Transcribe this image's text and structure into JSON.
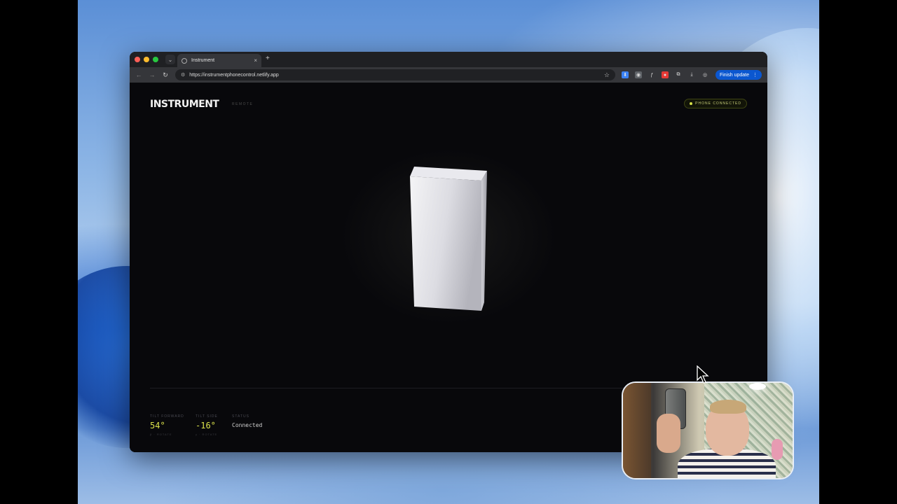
{
  "browser": {
    "tab_title": "Instrument",
    "tab_close": "×",
    "new_tab": "+",
    "url": "https://instrumentphonecontrol.netlify.app",
    "finish_update_label": "Finish update",
    "finish_update_menu": "⋮",
    "back": "←",
    "forward": "→",
    "reload": "↻",
    "bookmark": "☆",
    "tab_menu": "⌄"
  },
  "app": {
    "brand": "INSTRUMENT",
    "brand_sub": "REMOTE",
    "status_pill": "PHONE CONNECTED",
    "stats": [
      {
        "label": "TILT FORWARD",
        "value": "54°",
        "hint": "β · ROTATE"
      },
      {
        "label": "TILT SIDE",
        "value": "-16°",
        "hint": "γ · ROTATE"
      },
      {
        "label": "STATUS",
        "value": "Connected"
      }
    ]
  },
  "colors": {
    "accent": "#d9e04a",
    "page_background": "#08080b",
    "finish_update": "#0b57d0"
  }
}
